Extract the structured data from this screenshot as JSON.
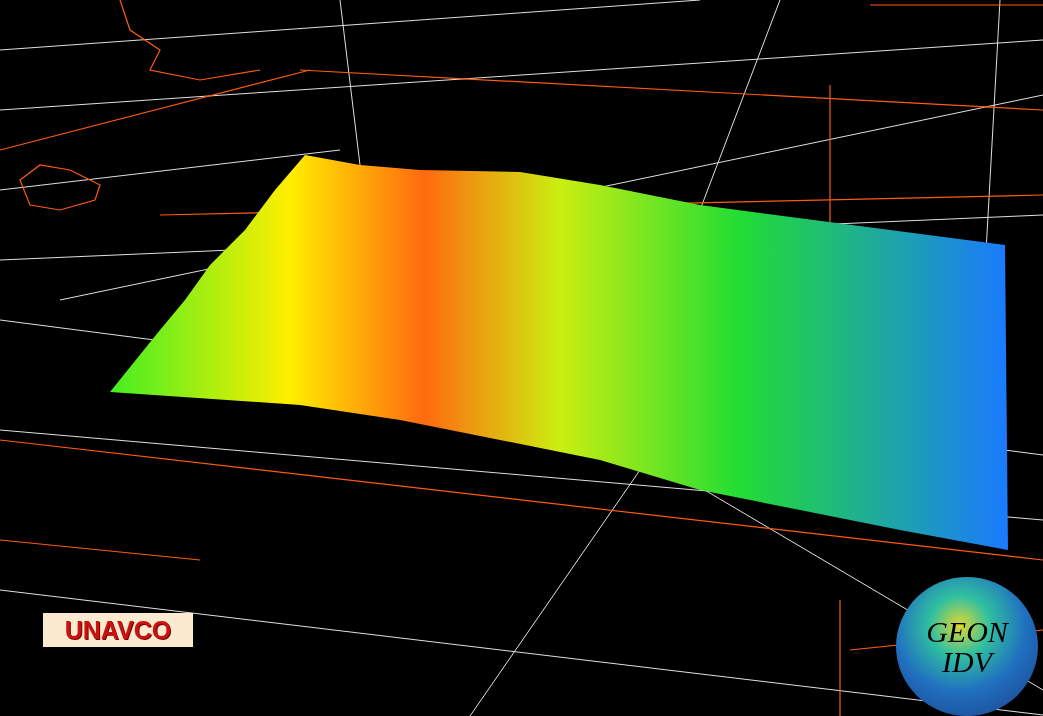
{
  "view": {
    "logos": [
      {
        "kind": "badge",
        "text": "UNAVCO"
      },
      {
        "kind": "globe",
        "lines": [
          "GEON",
          "IDV"
        ]
      }
    ]
  }
}
